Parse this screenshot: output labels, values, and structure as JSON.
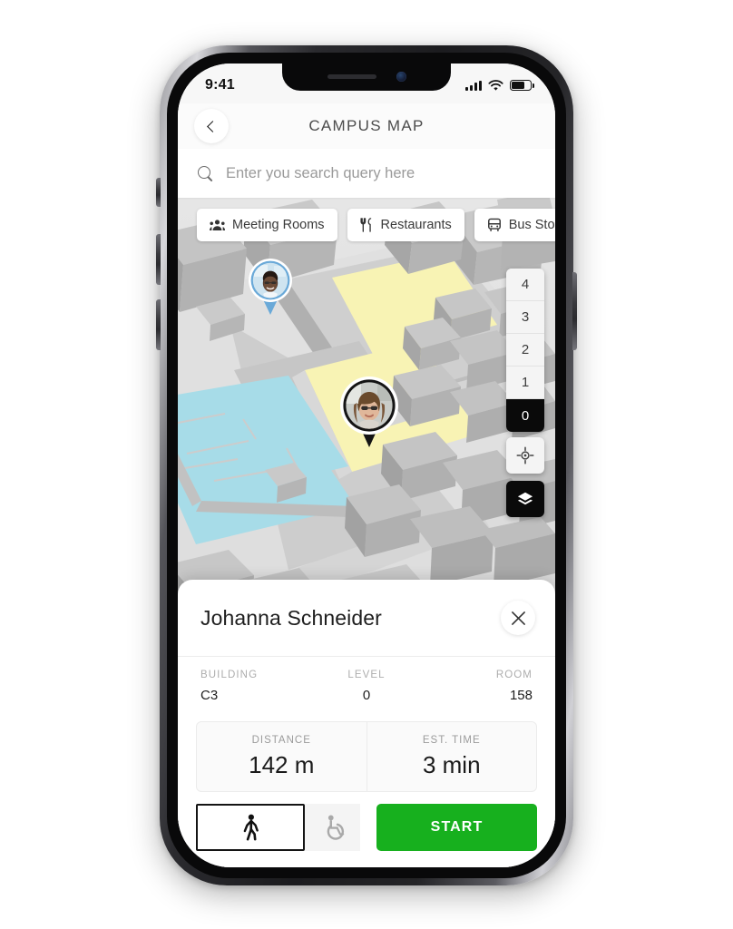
{
  "status_bar": {
    "time": "9:41",
    "signal_icon": "cellular-bars-icon",
    "wifi_icon": "wifi-icon",
    "battery_icon": "battery-icon",
    "battery_level_pct": 70
  },
  "header": {
    "title": "CAMPUS MAP",
    "back_icon": "chevron-left-icon"
  },
  "search": {
    "icon": "search-icon",
    "value": "",
    "placeholder": "Enter you search query here"
  },
  "filters": {
    "chips": [
      {
        "label": "Meeting Rooms",
        "icon": "people-group-icon"
      },
      {
        "label": "Restaurants",
        "icon": "fork-knife-icon"
      },
      {
        "label": "Bus Stop",
        "icon": "bus-icon"
      },
      {
        "label": "",
        "icon": "tram-icon"
      }
    ]
  },
  "map": {
    "level_selector": {
      "levels": [
        "4",
        "3",
        "2",
        "1",
        "0"
      ],
      "selected": "0"
    },
    "tools": [
      {
        "name": "locate-me",
        "icon": "crosshair-icon"
      },
      {
        "name": "layers",
        "icon": "layers-icon"
      }
    ],
    "markers": [
      {
        "name": "colleague-marker",
        "state": "unselected",
        "border_color": "#6aa9d8"
      },
      {
        "name": "selected-person-marker",
        "state": "selected",
        "border_color": "#141414"
      }
    ],
    "colors": {
      "background": "#dcdcdc",
      "building": "#b4b4b4",
      "building_top": "#c8c8c8",
      "highlight_yellow": "#f8f3b4",
      "highlight_cyan": "#a7dce8",
      "ground": "#e3e3e3"
    }
  },
  "detail_sheet": {
    "person_name": "Johanna Schneider",
    "close_icon": "close-icon",
    "meta": [
      {
        "label": "BUILDING",
        "value": "C3"
      },
      {
        "label": "LEVEL",
        "value": "0"
      },
      {
        "label": "ROOM",
        "value": "158"
      }
    ],
    "stats": [
      {
        "label": "DISTANCE",
        "value": "142 m"
      },
      {
        "label": "EST. TIME",
        "value": "3 min"
      }
    ],
    "modes": [
      {
        "name": "walking",
        "icon": "pedestrian-icon",
        "selected": true
      },
      {
        "name": "wheelchair",
        "icon": "wheelchair-icon",
        "selected": false
      }
    ],
    "start_label": "START",
    "start_color": "#17b01e"
  }
}
